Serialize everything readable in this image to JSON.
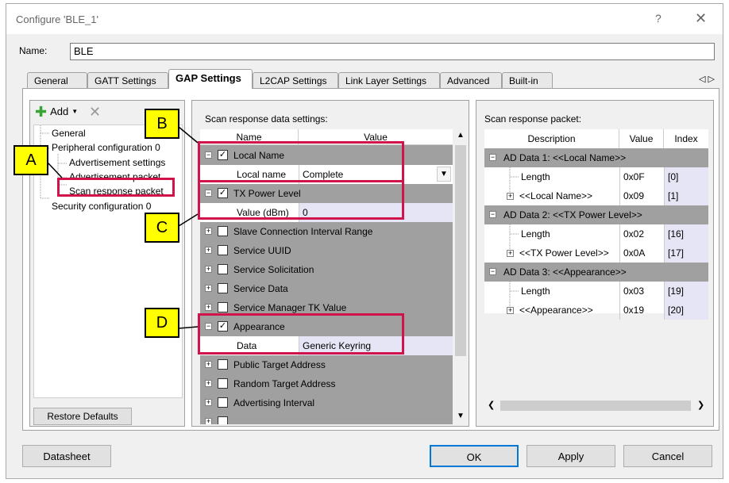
{
  "window": {
    "title": "Configure 'BLE_1'",
    "help": "?",
    "close": "✕"
  },
  "name_field": {
    "label": "Name:",
    "value": "BLE"
  },
  "tabs": [
    "General",
    "GATT Settings",
    "GAP Settings",
    "L2CAP Settings",
    "Link Layer Settings",
    "Advanced",
    "Built-in"
  ],
  "tab_arrows": "◁ ▷",
  "left": {
    "add_label": "Add",
    "tree": [
      "General",
      "Peripheral configuration 0",
      "Advertisement settings",
      "Advertisement packet",
      "Scan response packet",
      "Security configuration 0"
    ],
    "restore": "Restore Defaults"
  },
  "mid": {
    "title": "Scan response data settings:",
    "col_name": "Name",
    "col_value": "Value",
    "rows": [
      {
        "label": "Local Name",
        "checked": "✓"
      },
      {
        "label": "Local name",
        "value": "Complete"
      },
      {
        "label": "TX Power Level",
        "checked": "✓"
      },
      {
        "label": "Value (dBm)",
        "value": "0"
      },
      {
        "label": "Slave Connection Interval Range"
      },
      {
        "label": "Service UUID"
      },
      {
        "label": "Service Solicitation"
      },
      {
        "label": "Service Data"
      },
      {
        "label": "Service Manager TK Value"
      },
      {
        "label": "Appearance",
        "checked": "✓"
      },
      {
        "label": "Data",
        "value": "Generic Keyring"
      },
      {
        "label": "Public Target Address"
      },
      {
        "label": "Random Target Address"
      },
      {
        "label": "Advertising Interval"
      }
    ]
  },
  "right": {
    "title": "Scan response packet:",
    "col_desc": "Description",
    "col_value": "Value",
    "col_index": "Index",
    "rows": [
      {
        "desc": "AD Data 1: <<Local Name>>"
      },
      {
        "desc": "Length",
        "value": "0x0F",
        "index": "[0]"
      },
      {
        "desc": "<<Local Name>>",
        "value": "0x09",
        "index": "[1]"
      },
      {
        "desc": "AD Data 2: <<TX Power Level>>"
      },
      {
        "desc": "Length",
        "value": "0x02",
        "index": "[16]"
      },
      {
        "desc": "<<TX Power Level>>",
        "value": "0x0A",
        "index": "[17]"
      },
      {
        "desc": "AD Data 3: <<Appearance>>"
      },
      {
        "desc": "Length",
        "value": "0x03",
        "index": "[19]"
      },
      {
        "desc": "<<Appearance>>",
        "value": "0x19",
        "index": "[20]"
      }
    ]
  },
  "buttons": {
    "datasheet": "Datasheet",
    "ok": "OK",
    "apply": "Apply",
    "cancel": "Cancel"
  },
  "callouts": {
    "a": "A",
    "b": "B",
    "c": "C",
    "d": "D"
  },
  "colors": {
    "highlight": "#d0134a",
    "callout": "#ffff00",
    "category_row": "#a0a0a0",
    "selected_cell": "#e5e5f5"
  }
}
